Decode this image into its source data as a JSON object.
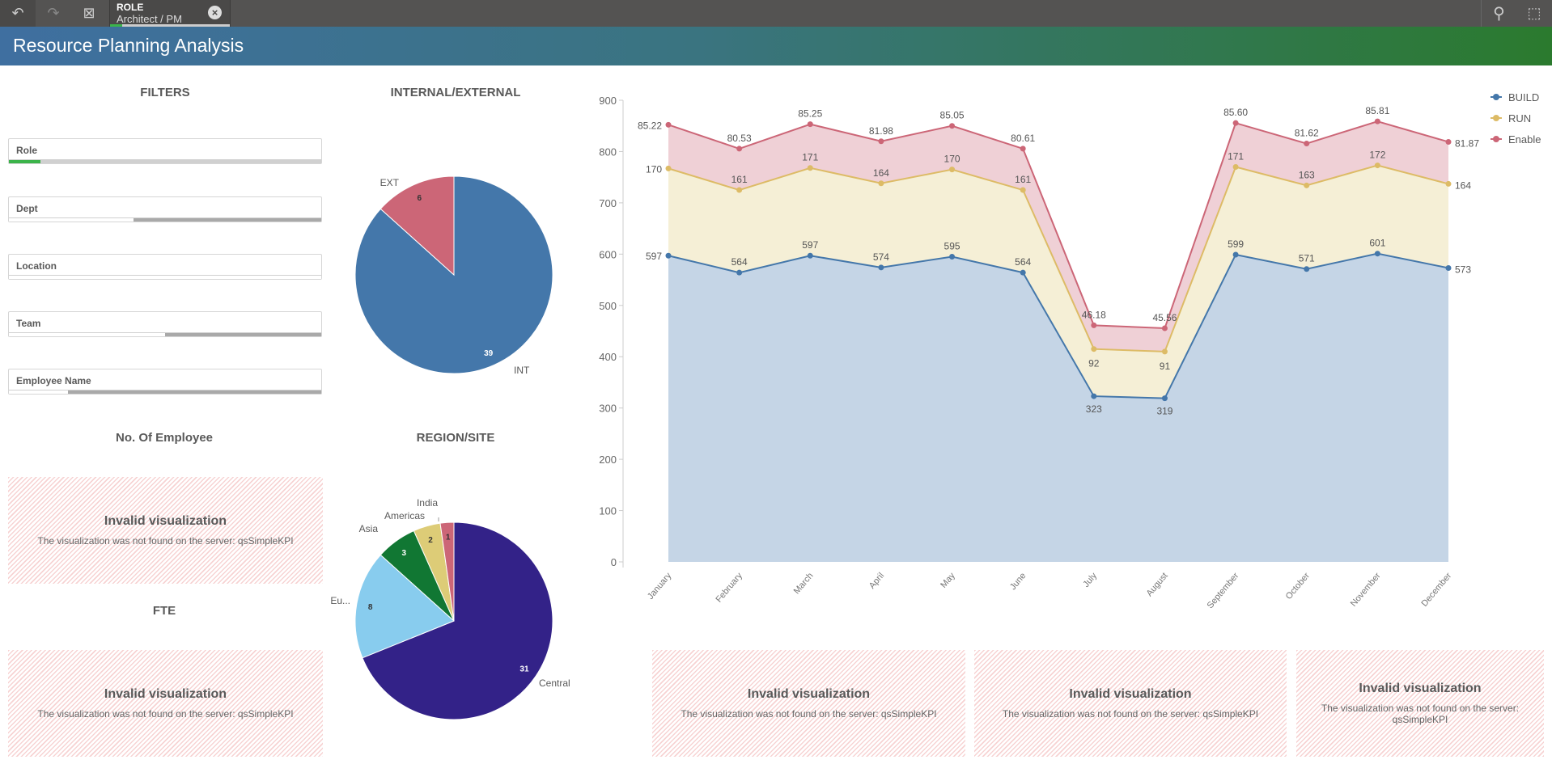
{
  "toolbar": {
    "back_icon": "step-back-icon",
    "forward_icon": "step-forward-icon",
    "clear_icon": "clear-selections-icon",
    "search_icon": "search-icon",
    "select_icon": "selection-tool-icon",
    "selection": {
      "field": "ROLE",
      "value": "Architect / PM",
      "close_icon": "close-circle-icon",
      "accent": "#3bb44a"
    }
  },
  "header": {
    "title": "Resource Planning Analysis"
  },
  "filters": {
    "title": "FILTERS",
    "items": [
      {
        "label": "Role",
        "fill_fraction": 0.1,
        "selected": true
      },
      {
        "label": "Dept",
        "fill_fraction": 0.6
      },
      {
        "label": "Location",
        "fill_fraction": 0
      },
      {
        "label": "Team",
        "fill_fraction": 0.5
      },
      {
        "label": "Employee Name",
        "fill_fraction": 0.81
      }
    ]
  },
  "internal_external": {
    "title": "INTERNAL/EXTERNAL"
  },
  "region_site": {
    "title": "REGION/SITE"
  },
  "no_of_employee": {
    "title": "No. Of Employee"
  },
  "fte": {
    "title": "FTE"
  },
  "invalid": {
    "title": "Invalid visualization",
    "message": "The visualization was not found on the server: qsSimpleKPI"
  },
  "chart_data": [
    {
      "type": "pie",
      "title": "INTERNAL/EXTERNAL",
      "categories": [
        "INT",
        "EXT"
      ],
      "values": [
        39,
        6
      ],
      "colors": [
        "#4477aa",
        "#cc6677"
      ]
    },
    {
      "type": "pie",
      "title": "REGION/SITE",
      "categories": [
        "Central",
        "Eu...",
        "Asia",
        "Americas",
        "India"
      ],
      "values": [
        31,
        8,
        3,
        2,
        1
      ],
      "colors": [
        "#332288",
        "#88ccee",
        "#117733",
        "#ddcc77",
        "#cc6677"
      ]
    },
    {
      "type": "area",
      "stacked": true,
      "ylim": [
        0,
        900
      ],
      "yticks": [
        0,
        100,
        200,
        300,
        400,
        500,
        600,
        700,
        800,
        900
      ],
      "legend": "top-right",
      "categories": [
        "January",
        "February",
        "March",
        "April",
        "May",
        "June",
        "July",
        "August",
        "September",
        "October",
        "November",
        "December"
      ],
      "series": [
        {
          "name": "BUILD",
          "color": "#4477aa",
          "fill": "#c5d5e6",
          "values": [
            597,
            564,
            597,
            574,
            595,
            564,
            323,
            319,
            599,
            571,
            601,
            573
          ],
          "labels": [
            "597",
            "564",
            "597",
            "574",
            "595",
            "564",
            "323",
            "319",
            "599",
            "571",
            "601",
            "573"
          ]
        },
        {
          "name": "RUN",
          "color": "#ddbb66",
          "fill": "#f5efd6",
          "values": [
            170,
            161,
            171,
            164,
            170,
            161,
            92,
            91,
            171,
            163,
            172,
            164
          ],
          "labels": [
            "170",
            "161",
            "171",
            "164",
            "170",
            "161",
            "92",
            "91",
            "171",
            "163",
            "172",
            "164"
          ]
        },
        {
          "name": "Enable",
          "color": "#cc6677",
          "fill": "#efd0d6",
          "values": [
            85.22,
            80.53,
            85.25,
            81.98,
            85.05,
            80.61,
            46.18,
            45.56,
            85.6,
            81.62,
            85.81,
            81.87
          ],
          "labels": [
            "85.22",
            "80.53",
            "85.25",
            "81.98",
            "85.05",
            "80.61",
            "46.18",
            "45.56",
            "85.60",
            "81.62",
            "85.81",
            "81.87"
          ]
        }
      ]
    }
  ]
}
